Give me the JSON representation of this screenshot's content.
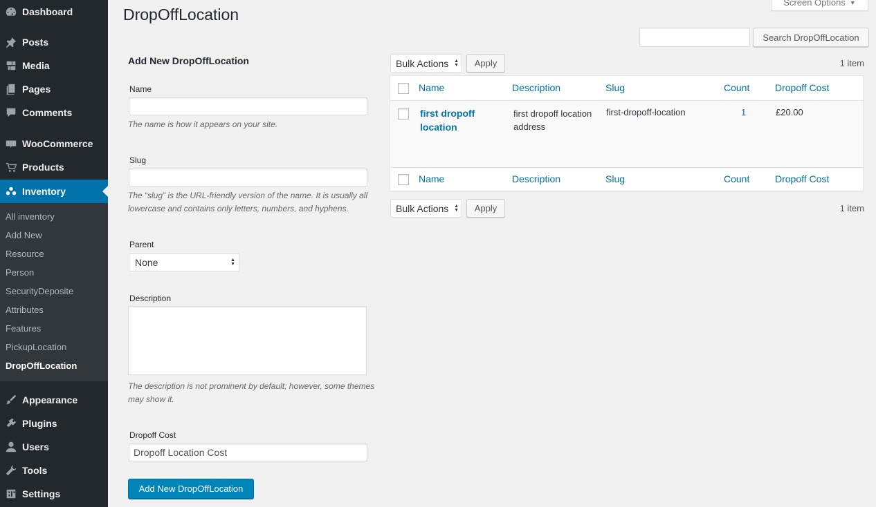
{
  "sidebar": {
    "items": [
      {
        "label": "Dashboard",
        "icon": "dashboard-icon"
      },
      {
        "label": "Posts",
        "icon": "pin-icon"
      },
      {
        "label": "Media",
        "icon": "media-icon"
      },
      {
        "label": "Pages",
        "icon": "pages-icon"
      },
      {
        "label": "Comments",
        "icon": "comment-icon"
      },
      {
        "label": "WooCommerce",
        "icon": "woocommerce-icon"
      },
      {
        "label": "Products",
        "icon": "cart-icon"
      },
      {
        "label": "Inventory",
        "icon": "groups-icon"
      },
      {
        "label": "Appearance",
        "icon": "brush-icon"
      },
      {
        "label": "Plugins",
        "icon": "plugin-icon"
      },
      {
        "label": "Users",
        "icon": "user-icon"
      },
      {
        "label": "Tools",
        "icon": "wrench-icon"
      },
      {
        "label": "Settings",
        "icon": "settings-icon"
      }
    ],
    "submenu": [
      "All inventory",
      "Add New",
      "Resource",
      "Person",
      "SecurityDeposite",
      "Attributes",
      "Features",
      "PickupLocation",
      "DropOffLocation"
    ],
    "accent_color": "#0073aa"
  },
  "header": {
    "title": "DropOffLocation",
    "screen_options": "Screen Options"
  },
  "search": {
    "button": "Search DropOffLocation",
    "value": ""
  },
  "form": {
    "title": "Add New DropOffLocation",
    "name_label": "Name",
    "name_value": "",
    "name_help": "The name is how it appears on your site.",
    "slug_label": "Slug",
    "slug_value": "",
    "slug_help": "The “slug” is the URL-friendly version of the name. It is usually all lowercase and contains only letters, numbers, and hyphens.",
    "parent_label": "Parent",
    "parent_value": "None",
    "description_label": "Description",
    "description_help": "The description is not prominent by default; however, some themes may show it.",
    "cost_label": "Dropoff Cost",
    "cost_placeholder": "Dropoff Location Cost",
    "submit": "Add New DropOffLocation"
  },
  "list": {
    "bulk_actions": "Bulk Actions",
    "apply": "Apply",
    "item_count": "1 item",
    "columns": [
      "Name",
      "Description",
      "Slug",
      "Count",
      "Dropoff Cost"
    ],
    "rows": [
      {
        "name": "first dropoff location",
        "description": "first dropoff location address",
        "slug": "first-dropoff-location",
        "count": "1",
        "cost": "£20.00"
      }
    ]
  }
}
